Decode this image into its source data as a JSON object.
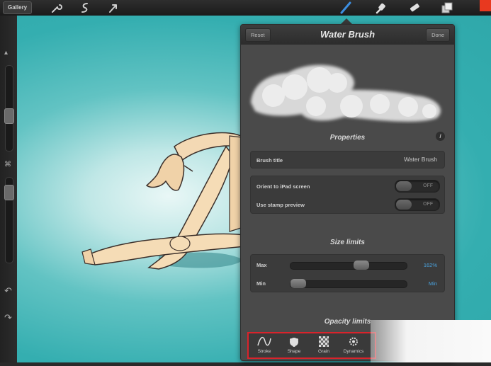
{
  "topbar": {
    "gallery_label": "Gallery",
    "active_color": "#e8391f",
    "tools": [
      "wrench-icon",
      "smudge-s-icon",
      "arrow-cursor-icon",
      "brush-icon",
      "smudge-icon",
      "eraser-icon",
      "layers-icon"
    ]
  },
  "panel": {
    "reset_label": "Reset",
    "title": "Water Brush",
    "done_label": "Done",
    "properties_title": "Properties",
    "brush_title_label": "Brush title",
    "brush_title_value": "Water Brush",
    "orient_label": "Orient to iPad screen",
    "orient_state": "OFF",
    "stamp_label": "Use stamp preview",
    "stamp_state": "OFF",
    "size_limits_title": "Size limits",
    "max_label": "Max",
    "max_value": "162%",
    "max_fraction": 0.63,
    "min_label": "Min",
    "min_value": "Min",
    "min_fraction": 0.0,
    "opacity_limits_title": "Opacity limits",
    "tabs": [
      "Stroke",
      "Shape",
      "Grain",
      "Dynamics"
    ]
  },
  "colors": {
    "accent_blue": "#4aa3df",
    "highlight_red": "#d9232b",
    "canvas_teal": "#2fa8aa"
  }
}
